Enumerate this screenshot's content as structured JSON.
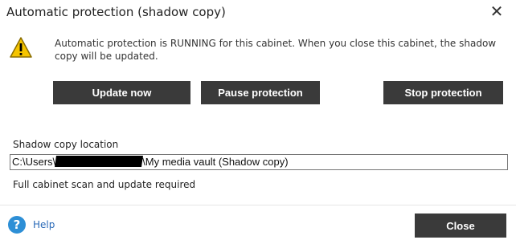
{
  "window": {
    "title": "Automatic protection (shadow copy)",
    "close_glyph": "✕"
  },
  "status": {
    "icon": "warning-icon",
    "message": "Automatic protection is RUNNING for this cabinet.  When you close this cabinet, the shadow copy will be updated."
  },
  "actions": {
    "update_label": "Update now",
    "pause_label": "Pause protection",
    "stop_label": "Stop protection"
  },
  "location": {
    "label": "Shadow copy location",
    "path_prefix": "C:\\Users\\",
    "path_suffix": "\\My media vault (Shadow copy)"
  },
  "scan_status": "Full cabinet scan and update required",
  "footer": {
    "help_label": "Help",
    "help_glyph": "?",
    "close_label": "Close"
  },
  "colors": {
    "button_bg": "#3a3a3a",
    "button_text": "#ffffff",
    "warning_yellow": "#f5c400",
    "help_blue": "#2d8fd6"
  }
}
